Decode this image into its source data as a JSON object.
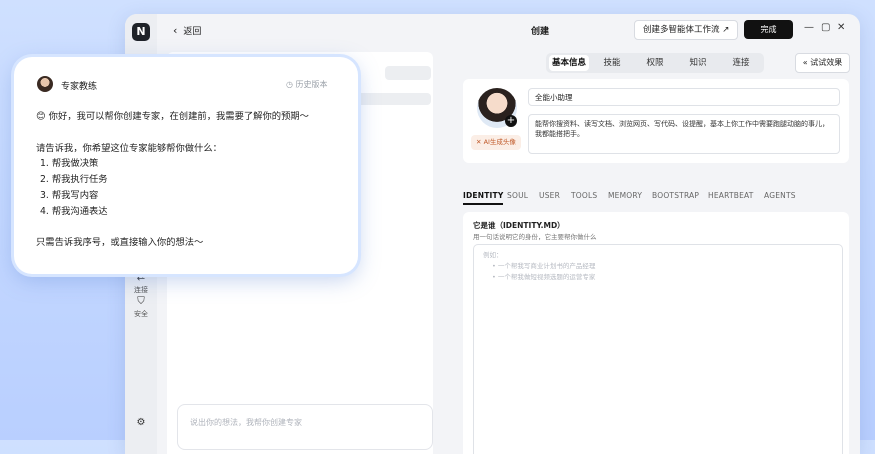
{
  "window": {
    "back_label": "返回",
    "title": "创建",
    "multi_agent_label": "创建多智能体工作流 ↗",
    "done_label": "完成",
    "controls": {
      "minimize": "—",
      "maximize": "▢",
      "close": "✕"
    }
  },
  "rail": {
    "items": [
      {
        "label": "连接",
        "icon": "link-icon"
      },
      {
        "label": "安全",
        "icon": "shield-icon"
      }
    ],
    "settings_icon": "gear-icon"
  },
  "chat_input": {
    "placeholder": "说出你的想法，我帮你创建专家"
  },
  "tabs": [
    {
      "label": "基本信息",
      "active": true
    },
    {
      "label": "技能"
    },
    {
      "label": "权限"
    },
    {
      "label": "知识"
    },
    {
      "label": "连接"
    }
  ],
  "try_label": "试试效果",
  "try_icon": "«",
  "profile": {
    "ai_avatar_label": "AI生成头像",
    "name_value": "全能小助理",
    "description_value": "能帮你搜资料、读写文档、浏览网页、写代码、设提醒，基本上你工作中需要跑腿动脑的事儿，我都能搭把手。"
  },
  "subtabs": [
    "IDENTITY",
    "SOUL",
    "USER",
    "TOOLS",
    "MEMORY",
    "BOOTSTRAP",
    "HEARTBEAT",
    "AGENTS"
  ],
  "identity": {
    "title": "它是谁（IDENTITY.MD）",
    "subtitle": "用一句话说明它的身份，它主要帮你做什么",
    "placeholder_intro": "例如：",
    "placeholder_items": [
      "一个帮我写商业计划书的产品经理",
      "一个帮我做短视频选题的运营专家"
    ]
  },
  "coach": {
    "name": "专家教练",
    "history_label": "历史版本",
    "greeting": "😊 你好，我可以帮你创建专家，在创建前，我需要了解你的预期～",
    "question": "请告诉我，你希望这位专家能够帮你做什么：",
    "options": [
      "1. 帮我做决策",
      "2. 帮我执行任务",
      "3. 帮我写内容",
      "4. 帮我沟通表达"
    ],
    "closing": "只需告诉我序号，或直接输入你的想法～"
  }
}
